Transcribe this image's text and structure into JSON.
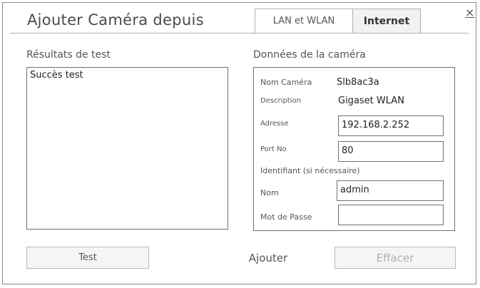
{
  "dialog": {
    "title": "Ajouter Caméra depuis",
    "close_label": "×"
  },
  "tabs": [
    {
      "label": "LAN et WLAN",
      "active": false
    },
    {
      "label": "Internet",
      "active": true
    }
  ],
  "results": {
    "heading": "Résultats de test",
    "text": "Succès test"
  },
  "camera": {
    "heading": "Données de la caméra",
    "name_label": "Nom Caméra",
    "name_value": "Slb8ac3a",
    "description_label": "Description",
    "description_value": "Gigaset WLAN",
    "address_label": "Adresse",
    "address_value": "192.168.2.252",
    "port_label": "Port No",
    "port_value": "80",
    "ident_label": "Identifiant (si nécessaire)",
    "user_label": "Nom",
    "user_value": "admin",
    "password_label": "Mot de Passe",
    "password_value": ""
  },
  "buttons": {
    "test_label": "Test",
    "add_label": "Ajouter",
    "clear_label": "Effacer"
  }
}
